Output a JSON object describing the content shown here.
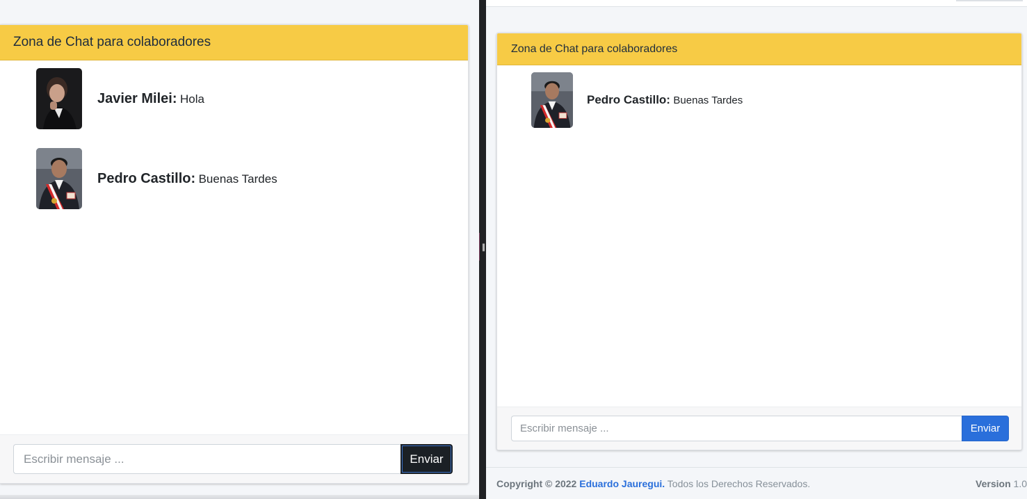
{
  "left_window": {
    "chat": {
      "header_title": "Zona de Chat para colaboradores",
      "messages": [
        {
          "author": "Javier Milei:",
          "text": "Hola"
        },
        {
          "author": "Pedro Castillo:",
          "text": "Buenas Tardes"
        }
      ],
      "input_placeholder": "Escribir mensaje ...",
      "send_label": "Enviar"
    }
  },
  "right_window": {
    "chat": {
      "header_title": "Zona de Chat para colaboradores",
      "messages": [
        {
          "author": "Pedro Castillo:",
          "text": "Buenas Tardes"
        }
      ],
      "input_placeholder": "Escribir mensaje ...",
      "send_label": "Enviar"
    },
    "footer": {
      "copyright_prefix": "Copyright © 2022",
      "author_link": "Eduardo Jauregui.",
      "rights": "Todos los Derechos Reservados.",
      "version_label": "Version",
      "version_value": "1.0"
    }
  },
  "colors": {
    "header_yellow": "#f7cb45",
    "send_dark": "#1b2025",
    "send_primary": "#2a6fdb",
    "divider": "#202124"
  },
  "icons": {
    "avatar_milei": "person-photo-dark-suit",
    "avatar_castillo": "person-photo-presidential-sash",
    "grip": "drag-handle-icon"
  }
}
